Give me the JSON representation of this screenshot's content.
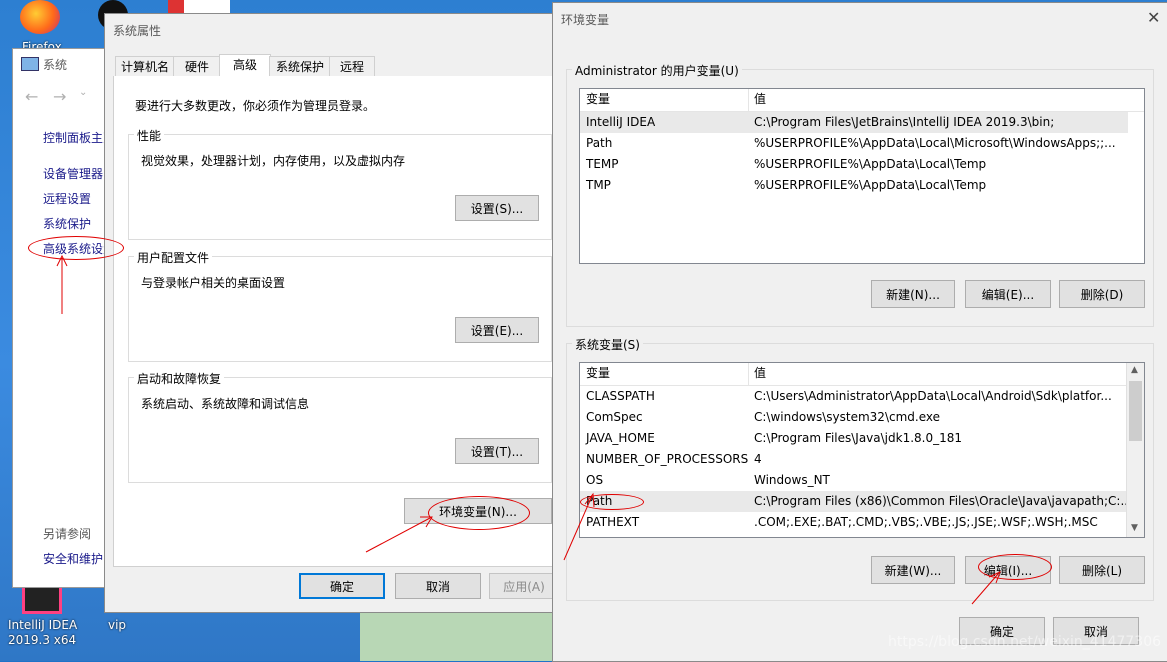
{
  "desktop": {
    "icons": [
      {
        "label": "Firefox"
      },
      {
        "label": "IntelliJ IDEA 2019.3 x64"
      },
      {
        "label": "vip"
      }
    ],
    "watermark": "https://blog.csdn.net/weixin_41477306"
  },
  "system_window": {
    "title": "系统",
    "control_panel_home": "控制面板主页",
    "links": [
      "设备管理器",
      "远程设置",
      "系统保护",
      "高级系统设置"
    ],
    "see_also": "另请参阅",
    "see_also_links": [
      "安全和维护"
    ]
  },
  "system_properties": {
    "title": "系统属性",
    "tabs": [
      {
        "label": "计算机名",
        "active": false
      },
      {
        "label": "硬件",
        "active": false
      },
      {
        "label": "高级",
        "active": true
      },
      {
        "label": "系统保护",
        "active": false
      },
      {
        "label": "远程",
        "active": false
      }
    ],
    "admin_note": "要进行大多数更改，你必须作为管理员登录。",
    "groups": [
      {
        "title": "性能",
        "description": "视觉效果，处理器计划，内存使用，以及虚拟内存",
        "button": "设置(S)..."
      },
      {
        "title": "用户配置文件",
        "description": "与登录帐户相关的桌面设置",
        "button": "设置(E)..."
      },
      {
        "title": "启动和故障恢复",
        "description": "系统启动、系统故障和调试信息",
        "button": "设置(T)..."
      }
    ],
    "env_button": "环境变量(N)...",
    "ok": "确定",
    "cancel": "取消",
    "apply": "应用(A)"
  },
  "env_vars": {
    "title": "环境变量",
    "user_section": "Administrator 的用户变量(U)",
    "columns": [
      "变量",
      "值"
    ],
    "user_vars": [
      {
        "name": "IntelliJ IDEA",
        "value": "C:\\Program Files\\JetBrains\\IntelliJ IDEA 2019.3\\bin;"
      },
      {
        "name": "Path",
        "value": "%USERPROFILE%\\AppData\\Local\\Microsoft\\WindowsApps;;..."
      },
      {
        "name": "TEMP",
        "value": "%USERPROFILE%\\AppData\\Local\\Temp"
      },
      {
        "name": "TMP",
        "value": "%USERPROFILE%\\AppData\\Local\\Temp"
      }
    ],
    "user_buttons": [
      "新建(N)...",
      "编辑(E)...",
      "删除(D)"
    ],
    "system_section": "系统变量(S)",
    "system_vars": [
      {
        "name": "CLASSPATH",
        "value": "C:\\Users\\Administrator\\AppData\\Local\\Android\\Sdk\\platfor..."
      },
      {
        "name": "ComSpec",
        "value": "C:\\windows\\system32\\cmd.exe"
      },
      {
        "name": "JAVA_HOME",
        "value": "C:\\Program Files\\Java\\jdk1.8.0_181"
      },
      {
        "name": "NUMBER_OF_PROCESSORS",
        "value": "4"
      },
      {
        "name": "OS",
        "value": "Windows_NT"
      },
      {
        "name": "Path",
        "value": "C:\\Program Files (x86)\\Common Files\\Oracle\\Java\\javapath;C:..."
      },
      {
        "name": "PATHEXT",
        "value": ".COM;.EXE;.BAT;.CMD;.VBS;.VBE;.JS;.JSE;.WSF;.WSH;.MSC"
      }
    ],
    "system_buttons": [
      "新建(W)...",
      "编辑(I)...",
      "删除(L)"
    ],
    "ok": "确定",
    "cancel": "取消"
  },
  "colors": {
    "annotation": "#e00000",
    "accent": "#0078d7"
  }
}
